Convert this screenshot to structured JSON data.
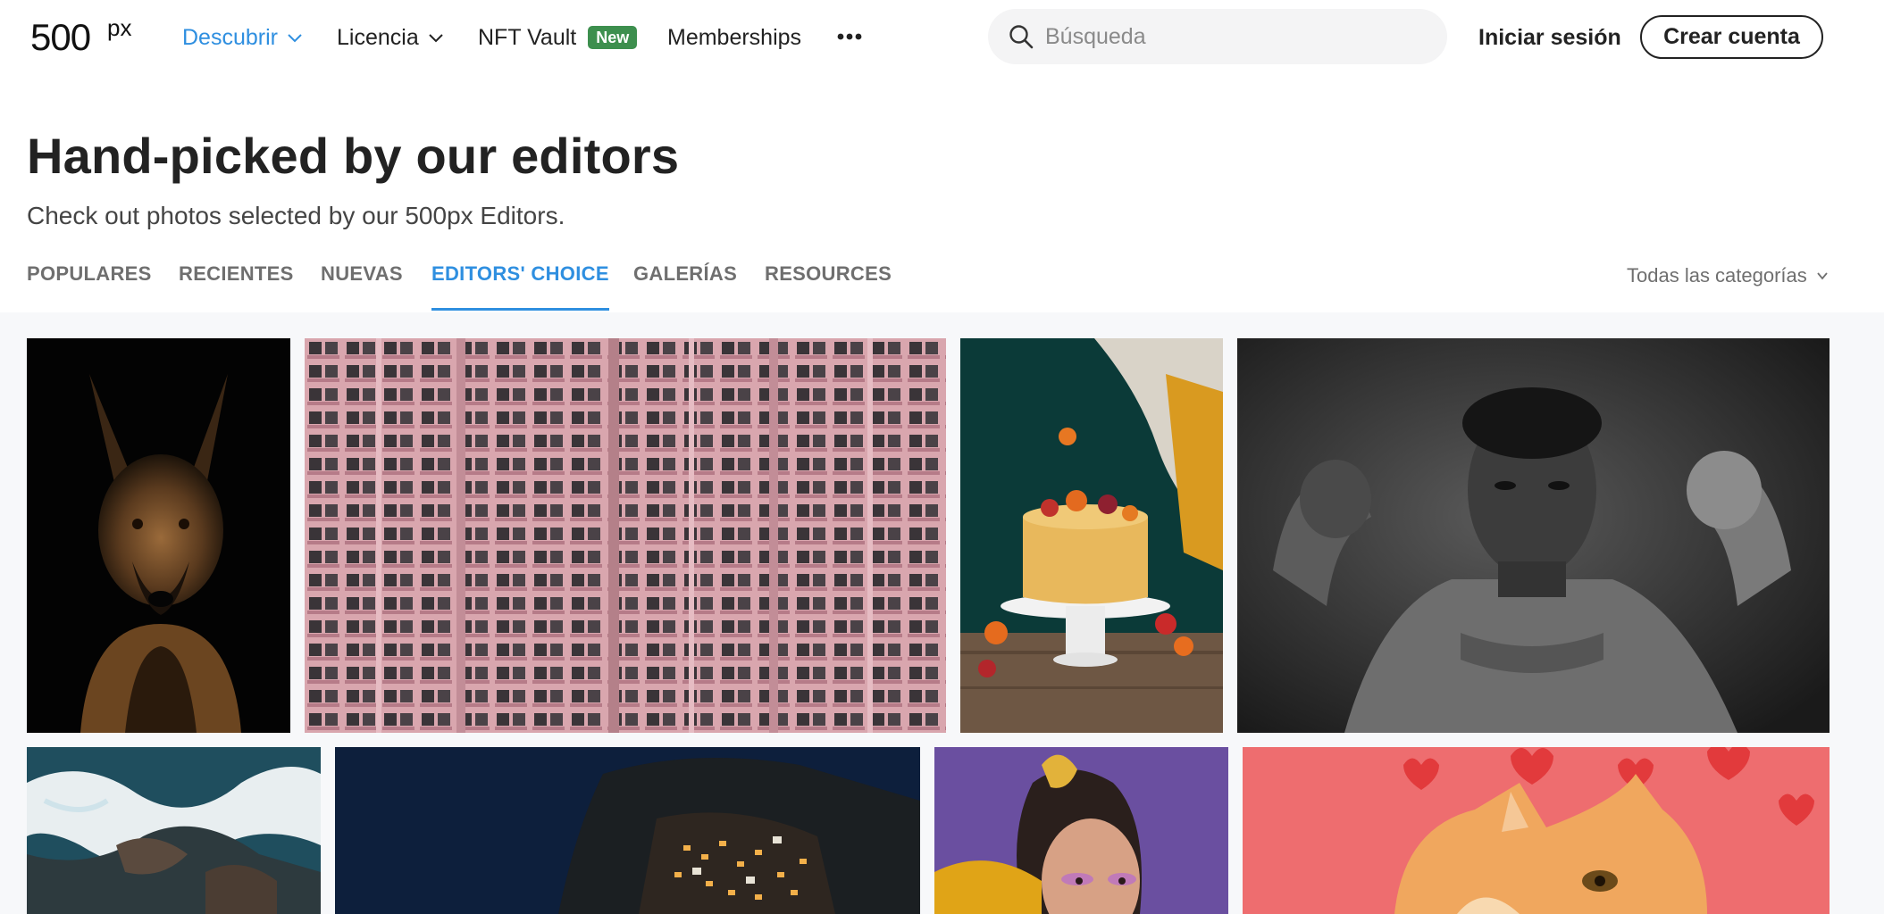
{
  "header": {
    "logo_text": "500px",
    "nav": [
      {
        "label": "Descubrir"
      },
      {
        "label": "Licencia"
      },
      {
        "label": "NFT Vault",
        "badge": "New"
      },
      {
        "label": "Memberships"
      }
    ],
    "search_placeholder": "Búsqueda",
    "login_label": "Iniciar sesión",
    "signup_label": "Crear cuenta"
  },
  "hero": {
    "title": "Hand-picked by our editors",
    "subtitle": "Check out photos selected by our 500px Editors."
  },
  "tabs": [
    {
      "label": "POPULARES"
    },
    {
      "label": "RECIENTES"
    },
    {
      "label": "NUEVAS"
    },
    {
      "label": "EDITORS' CHOICE",
      "active": true
    },
    {
      "label": "GALERÍAS"
    },
    {
      "label": "RESOURCES"
    }
  ],
  "categories_label": "Todas las categorías",
  "colors": {
    "accent": "#2f8fe0",
    "badge": "#3d8f4e",
    "text": "#222222",
    "muted": "#6f6f6f"
  },
  "icons": {
    "search": "search-icon",
    "chevron": "chevron-down-icon",
    "more": "more-horizontal-icon"
  }
}
